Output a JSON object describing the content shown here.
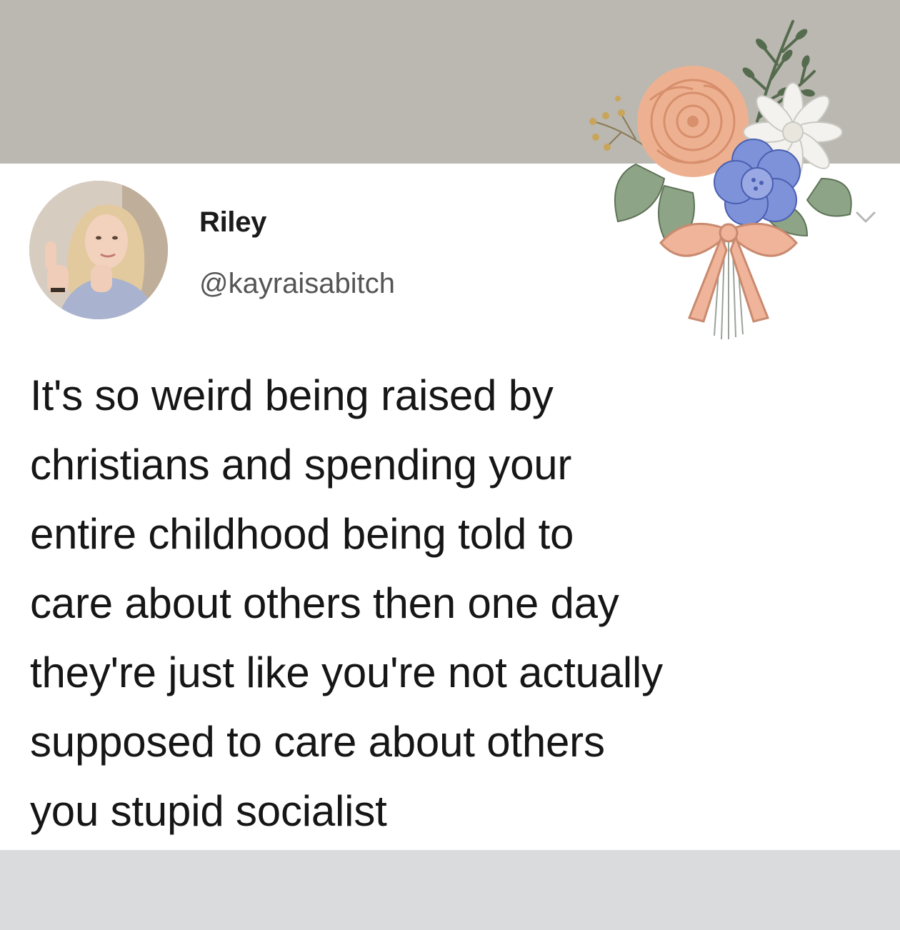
{
  "colors": {
    "banner": "#bbb8b1",
    "card_background": "#ffffff",
    "footer": "#d9dbdc",
    "text_primary": "#161616",
    "text_secondary": "#555555"
  },
  "header": {
    "decoration_icon": "flower-bouquet-icon"
  },
  "profile": {
    "display_name": "Riley",
    "handle": "@kayraisabitch",
    "avatar_icon": "profile-photo"
  },
  "menu": {
    "icon": "chevron-down-icon"
  },
  "tweet": {
    "text": "It's so weird being raised by\nchristians and spending your\nentire childhood being told to\ncare about others then one day\nthey're just like you're not actually\nsupposed to care about others\nyou stupid socialist"
  }
}
